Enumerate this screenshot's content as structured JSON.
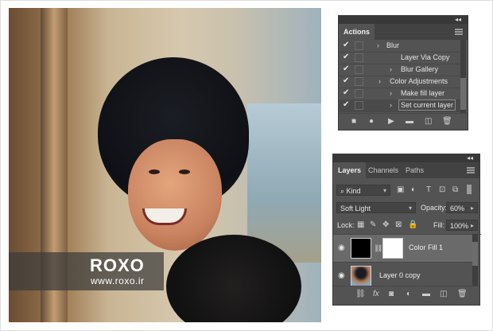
{
  "watermark": {
    "brand": "ROXO",
    "site": "www.roxo.ir"
  },
  "actions_panel": {
    "collapse_glyph": "◂◂",
    "close_glyph": "✕",
    "tab": "Actions",
    "rows": [
      {
        "label": "Blur",
        "arrow": "",
        "indent": 2
      },
      {
        "label": "Layer Via Copy",
        "arrow": "",
        "indent": 3
      },
      {
        "label": "Blur Gallery",
        "arrow": "›",
        "indent": 3
      },
      {
        "label": "Color Adjustments",
        "arrow": "›",
        "indent": 2
      },
      {
        "label": "Make fill layer",
        "arrow": "›",
        "indent": 3
      },
      {
        "label": "Set current layer",
        "arrow": "›",
        "indent": 3,
        "selected": true
      }
    ],
    "footer_icons": [
      "stop-icon",
      "record-icon",
      "play-icon",
      "new-set-icon",
      "new-action-icon",
      "trash-icon"
    ]
  },
  "layers_panel": {
    "collapse_glyph": "◂◂",
    "close_glyph": "✕",
    "tabs": [
      "Layers",
      "Channels",
      "Paths"
    ],
    "filter": {
      "label": "Kind"
    },
    "blend_mode": "Soft Light",
    "opacity": {
      "label": "Opacity:",
      "value": "60%"
    },
    "lock": {
      "label": "Lock:"
    },
    "fill": {
      "label": "Fill:",
      "value": "100%"
    },
    "layers": [
      {
        "name": "Color Fill 1",
        "selected": true
      },
      {
        "name": "Layer 0 copy",
        "selected": false
      }
    ]
  },
  "colors": {
    "panel_bg": "#535353",
    "panel_dark": "#424242",
    "selection": "#6a6a6a"
  }
}
